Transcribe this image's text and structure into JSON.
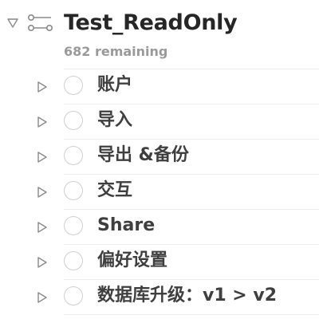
{
  "project": {
    "title": "Test_ReadOnly",
    "remaining": "682 remaining",
    "expanded": true,
    "icon": "project-nodes-icon"
  },
  "items": [
    {
      "label": "账户"
    },
    {
      "label": "导入"
    },
    {
      "label": "导出 &备份"
    },
    {
      "label": "交互"
    },
    {
      "label": "Share"
    },
    {
      "label": "偏好设置"
    },
    {
      "label": "数据库升级：v1 > v2"
    }
  ],
  "colors": {
    "title": "#262626",
    "subtitle": "#9a9a9a",
    "item_text": "#3f3f3f",
    "checkbox_border": "#cfcfcf",
    "divider": "#ececec",
    "icon_stroke": "#8a8a8a"
  }
}
